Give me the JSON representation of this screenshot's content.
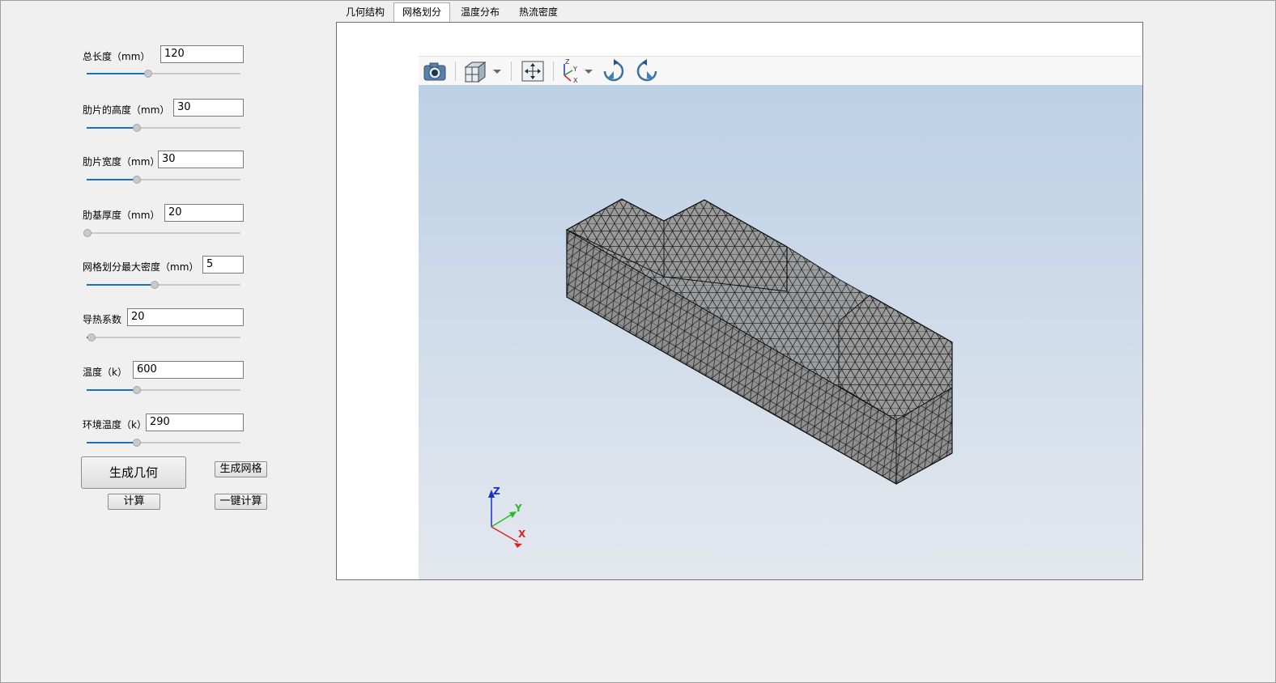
{
  "tabs": [
    "几何结构",
    "网格划分",
    "温度分布",
    "热流密度"
  ],
  "active_tab_index": 1,
  "params": [
    {
      "label": "总长度（mm）",
      "value": "120",
      "slider_fraction": 0.39
    },
    {
      "label": "肋片的高度（mm）",
      "value": "30",
      "slider_fraction": 0.32
    },
    {
      "label": "肋片宽度（mm）",
      "value": "30",
      "slider_fraction": 0.32
    },
    {
      "label": "肋基厚度（mm）",
      "value": "20",
      "slider_fraction": 0.0
    },
    {
      "label": "网格划分最大密度（mm）",
      "value": "5",
      "slider_fraction": 0.44
    },
    {
      "label": "导热系数",
      "value": "20",
      "slider_fraction": 0.03
    },
    {
      "label": "温度（k）",
      "value": "600",
      "slider_fraction": 0.32
    },
    {
      "label": "环境温度（k）",
      "value": "290",
      "slider_fraction": 0.32
    }
  ],
  "buttons": {
    "generate_geometry": "生成几何",
    "generate_mesh": "生成网格",
    "compute": "计算",
    "one_click_compute": "一键计算"
  },
  "toolbar_icons": [
    "camera-icon",
    "view-cube-icon",
    "dropdown-arrow-icon",
    "fit-view-icon",
    "axes-orientation-icon",
    "dropdown-arrow-icon",
    "rotate-clockwise-icon",
    "rotate-counterclockwise-icon"
  ],
  "axes": {
    "x": "X",
    "y": "Y",
    "z": "Z"
  },
  "colors": {
    "accent": "#1a6fc0",
    "mesh_fill": "#9a9a9a",
    "axis_x": "#e02020",
    "axis_y": "#20c020",
    "axis_z": "#1530d0"
  }
}
